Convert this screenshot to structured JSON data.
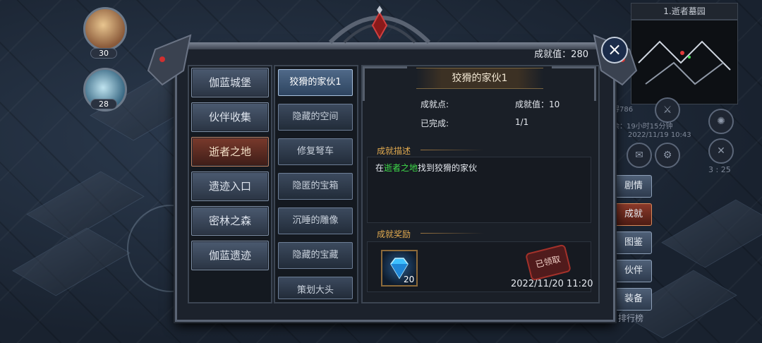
{
  "hud": {
    "avatar1_level": "30",
    "avatar2_level": "28",
    "map_title": "1.逝者墓园",
    "info_line1": "得786",
    "info_line2": "余：19小时15分钟",
    "info_line3": "2022/11/19 10:43",
    "clock": "3 : 25",
    "side_buttons": [
      "剧情",
      "成就",
      "图鉴",
      "伙伴",
      "装备"
    ],
    "ranking": "排行榜"
  },
  "panel": {
    "score_text": "成就值：280",
    "categories": [
      "伽蓝城堡",
      "伙伴收集",
      "逝者之地",
      "遗迹入口",
      "密林之森",
      "伽蓝遗迹"
    ],
    "active_category": "逝者之地",
    "subitems": [
      "狡猾的家伙1",
      "隐藏的空间",
      "修复弩车",
      "隐匿的宝箱",
      "沉睡的雕像",
      "隐藏的宝藏",
      "策划大头"
    ],
    "active_subitem": "狡猾的家伙1"
  },
  "detail": {
    "title": "狡猾的家伙1",
    "points_label": "成就点:",
    "points_value": "成就值：10",
    "done_label": "已完成:",
    "done_value": "1/1",
    "desc_title": "成就描述",
    "desc_prefix": "在",
    "desc_place": "逝者之地",
    "desc_suffix": "找到狡猾的家伙",
    "reward_title": "成就奖励",
    "reward_count": "20",
    "claimed": "已领取",
    "claim_time": "2022/11/20 11:20"
  },
  "colors": {
    "accent_gold": "#e0a94f",
    "place_green": "#3fdc4a",
    "active_red": "#7a3a2c",
    "active_blue": "#4f6988"
  },
  "icons": [
    "close-icon",
    "diamond-icon",
    "mail-icon",
    "settings-icon",
    "crest-icon"
  ]
}
